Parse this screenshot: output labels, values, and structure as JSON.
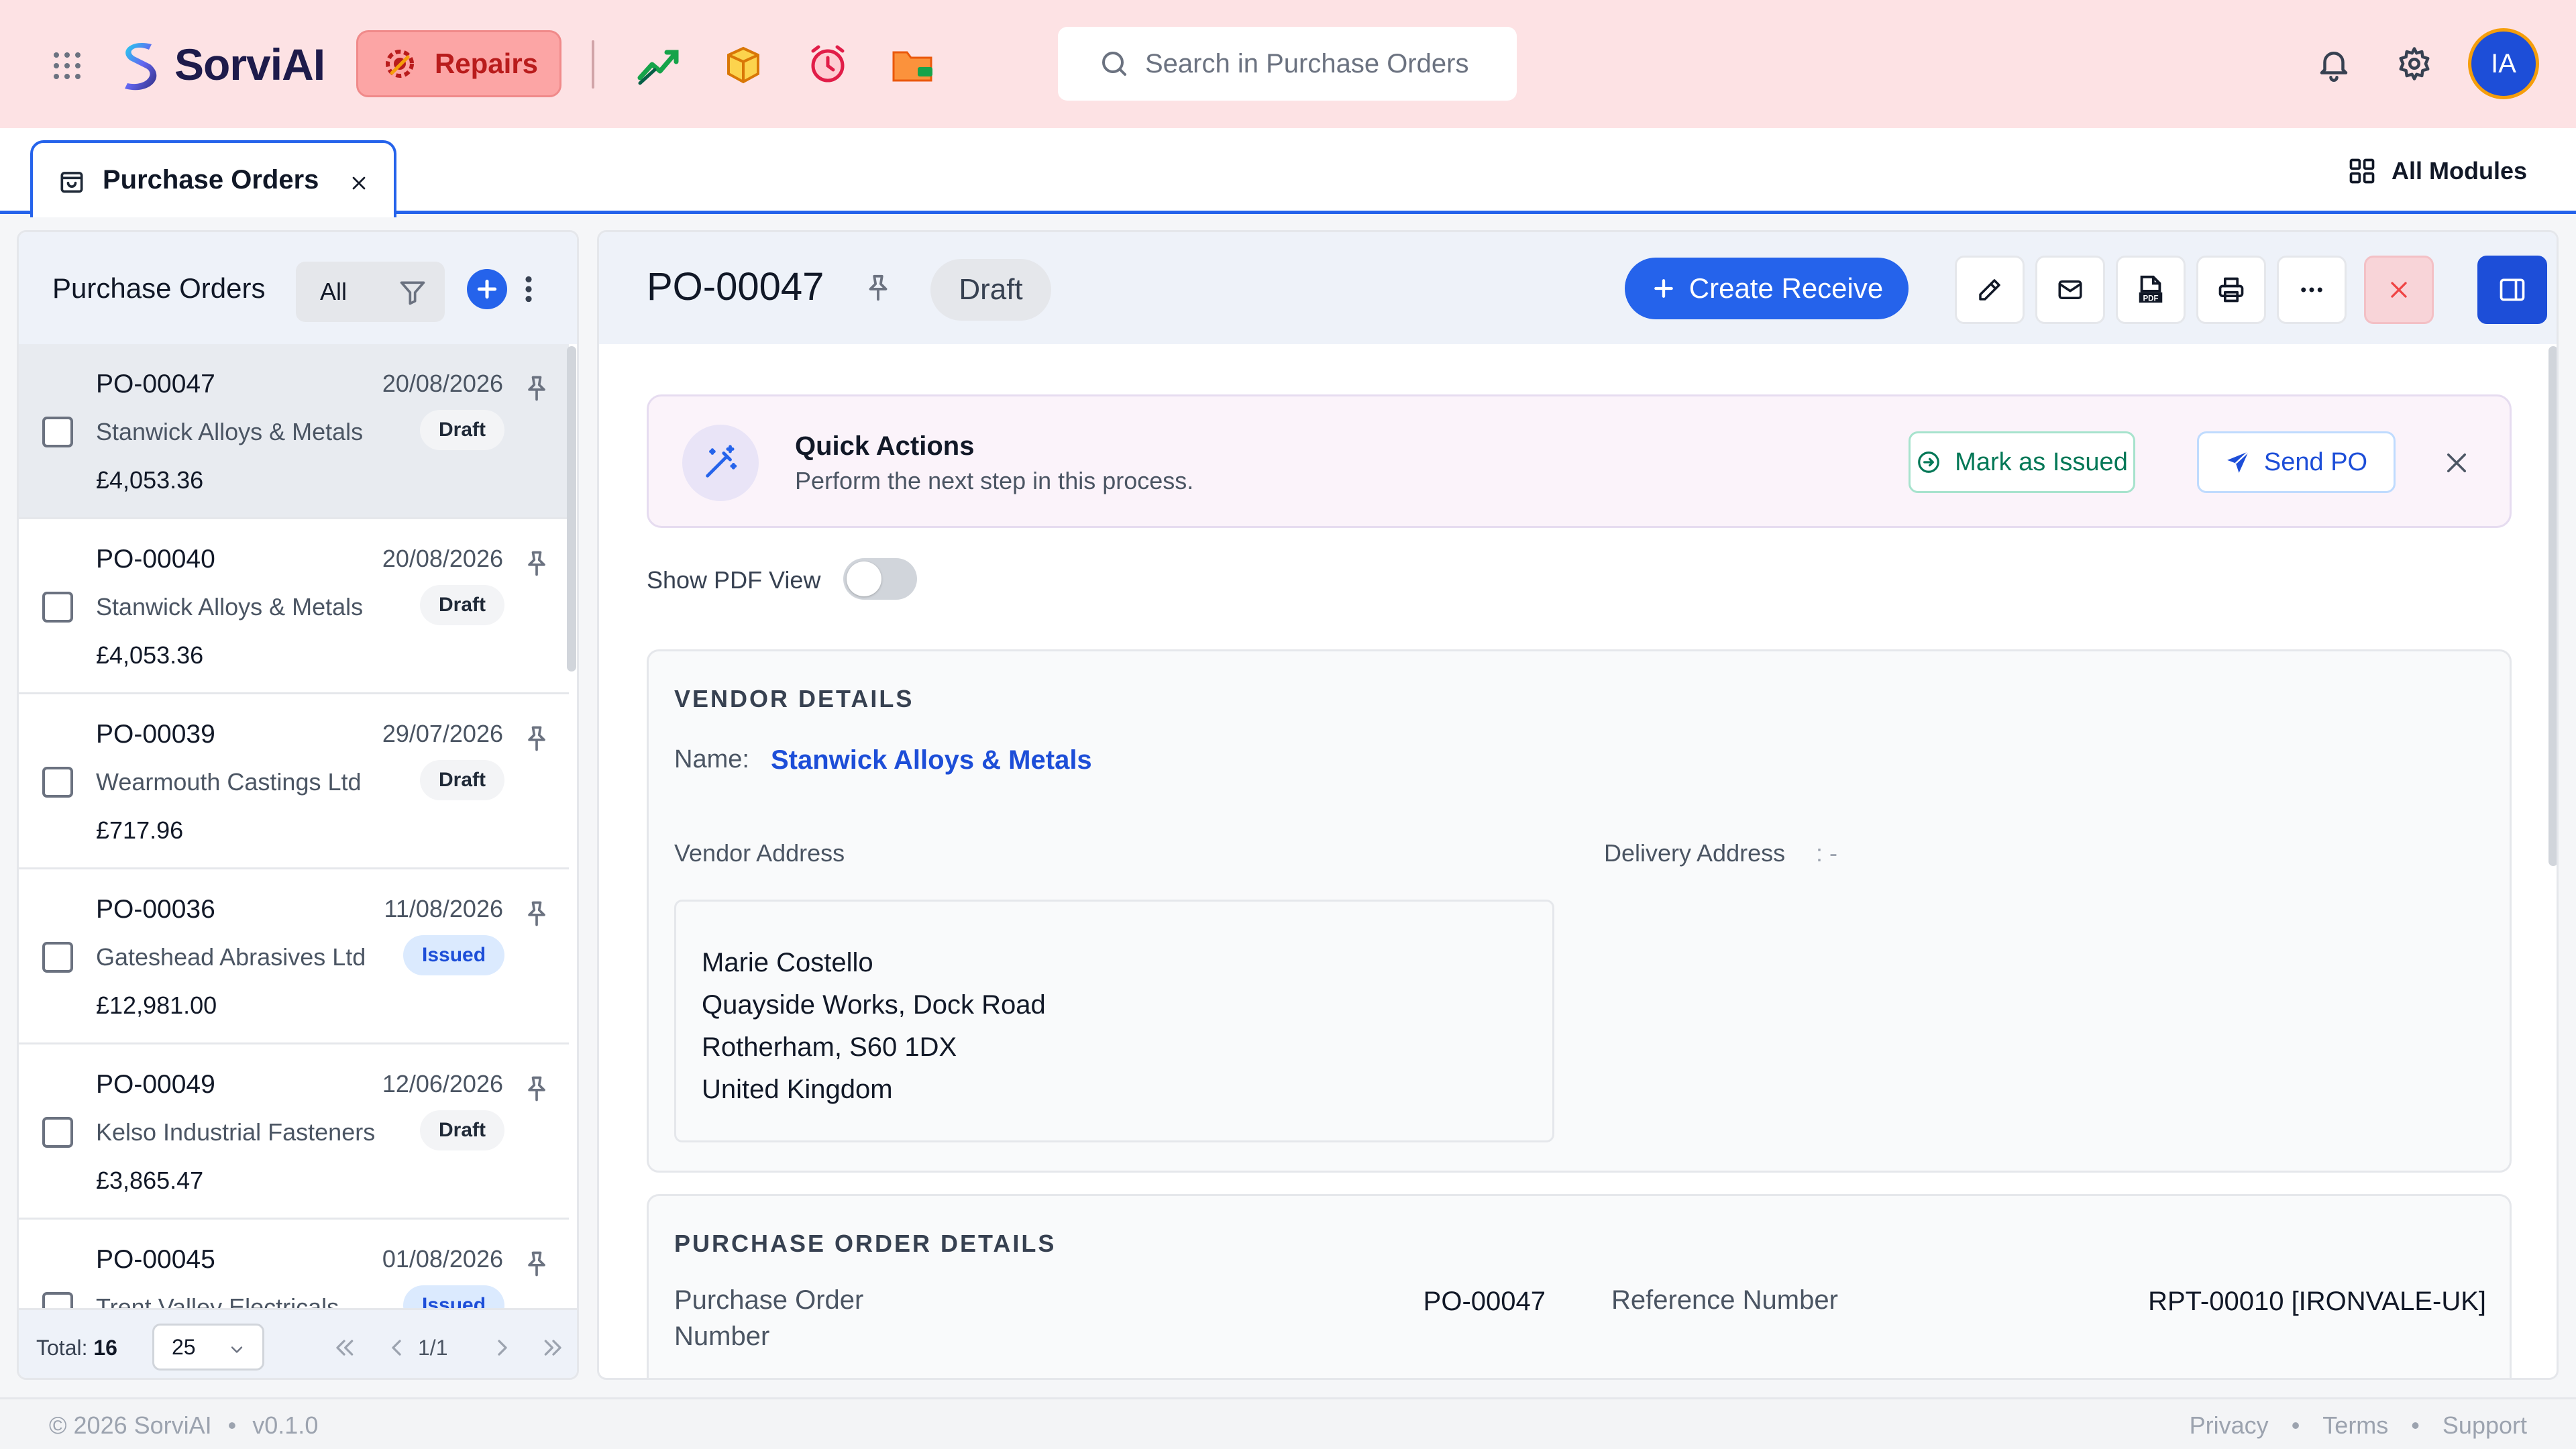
{
  "app": {
    "name": "SorviAI"
  },
  "topbar": {
    "module_label": "Repairs",
    "search_placeholder": "Search in Purchase Orders",
    "quick_apps": [
      "trending-chart-icon",
      "package-icon",
      "clock-alarm-icon",
      "folder-icon"
    ],
    "avatar_initials": "IA"
  },
  "tabs": {
    "active": {
      "label": "Purchase Orders"
    },
    "all_modules_label": "All Modules"
  },
  "list": {
    "title": "Purchase Orders",
    "filter_label": "All",
    "items": [
      {
        "po": "PO-00047",
        "date": "20/08/2026",
        "vendor": "Stanwick Alloys & Metals",
        "status": "Draft",
        "amount": "£4,053.36"
      },
      {
        "po": "PO-00040",
        "date": "20/08/2026",
        "vendor": "Stanwick Alloys & Metals",
        "status": "Draft",
        "amount": "£4,053.36"
      },
      {
        "po": "PO-00039",
        "date": "29/07/2026",
        "vendor": "Wearmouth Castings Ltd",
        "status": "Draft",
        "amount": "£717.96"
      },
      {
        "po": "PO-00036",
        "date": "11/08/2026",
        "vendor": "Gateshead Abrasives Ltd",
        "status": "Issued",
        "amount": "£12,981.00"
      },
      {
        "po": "PO-00049",
        "date": "12/06/2026",
        "vendor": "Kelso Industrial Fasteners",
        "status": "Draft",
        "amount": "£3,865.47"
      },
      {
        "po": "PO-00045",
        "date": "01/08/2026",
        "vendor": "Trent Valley Electricals",
        "status": "Issued",
        "amount": ""
      }
    ],
    "footer": {
      "total_label": "Total:",
      "total": "16",
      "per_page": "25",
      "page": "1/1"
    }
  },
  "detail": {
    "po_number": "PO-00047",
    "status": "Draft",
    "create_receive_label": "Create Receive",
    "quick_actions": {
      "title": "Quick Actions",
      "subtitle": "Perform the next step in this process.",
      "mark_issued_label": "Mark as Issued",
      "send_po_label": "Send PO"
    },
    "show_pdf_label": "Show PDF View",
    "show_pdf_on": false,
    "vendor": {
      "section_title": "VENDOR DETAILS",
      "name_label": "Name:",
      "name": "Stanwick Alloys & Metals",
      "address_label": "Vendor Address",
      "delivery_label": "Delivery Address",
      "delivery_value": ": -",
      "address_lines": [
        "Marie Costello",
        "Quayside Works, Dock Road",
        "Rotherham, S60 1DX",
        "United Kingdom"
      ]
    },
    "po_details": {
      "section_title": "PURCHASE ORDER DETAILS",
      "po_number_label_1": "Purchase Order",
      "po_number_label_2": "Number",
      "po_number_value": "PO-00047",
      "reference_label": "Reference Number",
      "reference_value": "RPT-00010 [IRONVALE-UK]"
    }
  },
  "footer": {
    "copyright": "© 2026 SorviAI",
    "version": "v0.1.0",
    "links": [
      "Privacy",
      "Terms",
      "Support"
    ]
  }
}
